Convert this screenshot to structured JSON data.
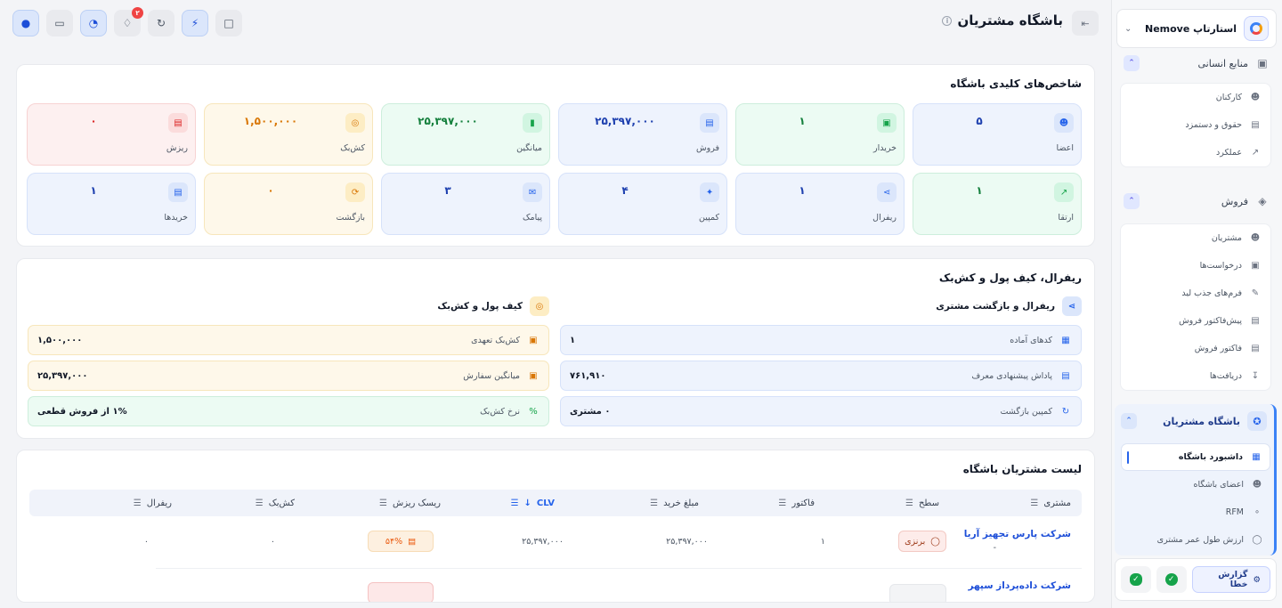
{
  "header": {
    "title": "باشگاه مشتریان",
    "info_icon": "info-icon",
    "notification_count": "۲"
  },
  "sidebar": {
    "brand": "استارتاپ Nemove",
    "sections": [
      {
        "label": "منابع انسانی",
        "items": [
          "کارکنان",
          "حقوق و دستمزد",
          "عملکرد"
        ]
      },
      {
        "label": "فروش",
        "items": [
          "مشتریان",
          "درخواست‌ها",
          "فرم‌های جذب لید",
          "پیش‌فاکتور فروش",
          "فاکتور فروش",
          "دریافت‌ها"
        ]
      }
    ],
    "club": {
      "label": "باشگاه مشتریان",
      "items": [
        "داشبورد باشگاه",
        "اعضای باشگاه",
        "RFM",
        "ارزش طول عمر مشتری"
      ]
    },
    "footer": {
      "report_error": "گزارش خطا"
    }
  },
  "kpis": {
    "title": "شاخص‌های کلیدی باشگاه",
    "row1": [
      {
        "label": "اعضا",
        "value": "۵",
        "color": "blue"
      },
      {
        "label": "خریدار",
        "value": "۱",
        "color": "green"
      },
      {
        "label": "فروش",
        "value": "۲۵,۳۹۷,۰۰۰",
        "color": "blue"
      },
      {
        "label": "میانگین",
        "value": "۲۵,۳۹۷,۰۰۰",
        "color": "green"
      },
      {
        "label": "کش‌بک",
        "value": "۱,۵۰۰,۰۰۰",
        "color": "yellow"
      },
      {
        "label": "ریزش",
        "value": "۰",
        "color": "red"
      }
    ],
    "row2": [
      {
        "label": "ارتقا",
        "value": "۱",
        "color": "green"
      },
      {
        "label": "ریفرال",
        "value": "۱",
        "color": "blue"
      },
      {
        "label": "کمپین",
        "value": "۴",
        "color": "blue"
      },
      {
        "label": "پیامک",
        "value": "۳",
        "color": "blue"
      },
      {
        "label": "بازگشت",
        "value": "۰",
        "color": "yellow"
      },
      {
        "label": "خریدها",
        "value": "۱",
        "color": "blue"
      }
    ]
  },
  "referral": {
    "title": "ریفرال، کیف پول و کش‌بک",
    "left_heading": "ریفرال و بازگشت مشتری",
    "right_heading": "کیف پول و کش‌بک",
    "left_rows": [
      {
        "label": "کدهای آماده",
        "value": "۱"
      },
      {
        "label": "پاداش پیشنهادی معرف",
        "value": "۷۶۱,۹۱۰"
      },
      {
        "label": "کمپین بازگشت",
        "value": "۰ مشتری"
      }
    ],
    "right_rows": [
      {
        "label": "کش‌بک تعهدی",
        "value": "۱,۵۰۰,۰۰۰"
      },
      {
        "label": "میانگین سفارش",
        "value": "۲۵,۳۹۷,۰۰۰"
      },
      {
        "label": "نرخ کش‌بک",
        "value": "۱% از فروش قطعی"
      }
    ]
  },
  "customers": {
    "title": "لیست مشتریان باشگاه",
    "columns": [
      "مشتری",
      "سطح",
      "فاکتور",
      "مبلغ خرید",
      "CLV",
      "ریسک ریزش",
      "کش‌بک",
      "ریفرال"
    ],
    "rows": [
      {
        "name": "شرکت پارس تجهیز آریا",
        "sub": "-",
        "level": "برنزی",
        "invoices": "۱",
        "amount": "۲۵,۳۹۷,۰۰۰",
        "clv": "۲۵,۳۹۷,۰۰۰",
        "risk": "۵۴%",
        "cashback": "۰",
        "referral": "۰"
      },
      {
        "name": "شرکت داده‌پرداز سپهر"
      }
    ]
  }
}
